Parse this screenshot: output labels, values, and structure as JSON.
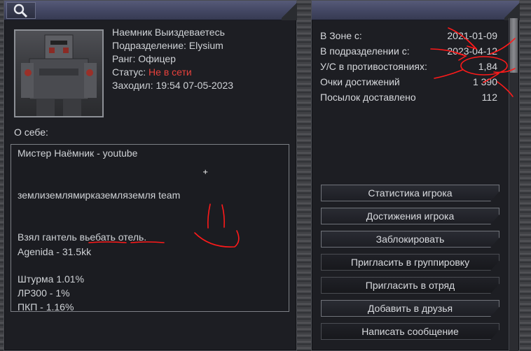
{
  "profile": {
    "info": [
      {
        "label": "Наемник Выиздеваетесь",
        "value": ""
      },
      {
        "label": "Подразделение: Elysium",
        "value": ""
      },
      {
        "label": "Ранг: Офицер",
        "value": ""
      },
      {
        "label": "Статус:",
        "value": "Не в сети"
      },
      {
        "label": "Заходил: 19:54 07-05-2023",
        "value": ""
      }
    ],
    "about_label": "О себе:",
    "about_lines": [
      "Мистер Наёмник - youtube",
      "землиземлямирказемляземля team",
      "Взял гантель вьебать отель.",
      "Agenida - 31.5kk",
      "Штурма 1.01%",
      "ЛР300 - 1%",
      "ПКП - 1.16%"
    ]
  },
  "stats": [
    {
      "label": "В Зоне с:",
      "value": "2021-01-09"
    },
    {
      "label": "В подразделении с:",
      "value": "2023-04-12"
    },
    {
      "label": "У/С в противостояниях:",
      "value": "1,84"
    },
    {
      "label": "Очки достижений",
      "value": "1 390"
    },
    {
      "label": "Посылок доставлено",
      "value": "112"
    }
  ],
  "buttons": [
    {
      "label": "Статистика игрока"
    },
    {
      "label": "Достижения игрока"
    },
    {
      "label": "Заблокировать"
    },
    {
      "label": "Пригласить в группировку"
    },
    {
      "label": "Пригласить в отряд"
    },
    {
      "label": "Добавить в друзья"
    },
    {
      "label": "Написать сообщение"
    }
  ],
  "colors": {
    "status_offline": "#e8413c",
    "annotation_red": "#ff1a1a",
    "header": "#434763"
  },
  "icons": {
    "search": "magnifier"
  }
}
